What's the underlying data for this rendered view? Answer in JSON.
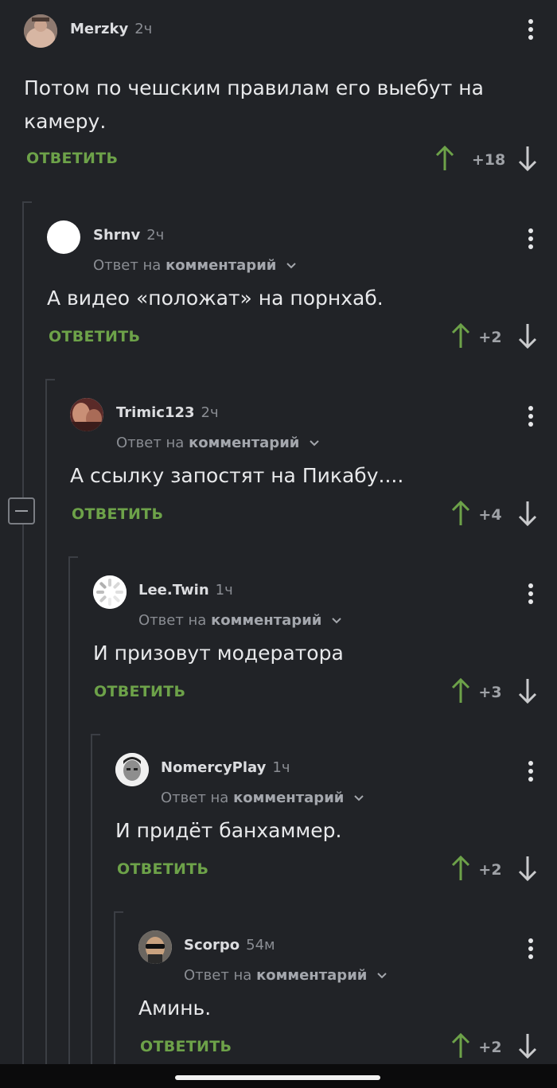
{
  "labels": {
    "reply_prefix": "Ответ на",
    "reply_target": "комментарий",
    "reply_button": "ОТВЕТИТЬ"
  },
  "colors": {
    "background": "#212327",
    "accent_green": "#6da249",
    "upvote": "#6da249",
    "downvote": "#c9cacc",
    "thread_line": "#3b3e44"
  },
  "comments": [
    {
      "author": "Merzky",
      "time": "2ч",
      "lines": [
        "Потом по чешским правилам его выебут на",
        "камеру."
      ],
      "score": "+18",
      "avatar": "avatar-photo"
    },
    {
      "author": "Shrnv",
      "time": "2ч",
      "lines": [
        "А видео «положат» на порнхаб."
      ],
      "score": "+2",
      "avatar": "avatar-blank"
    },
    {
      "author": "Trimic123",
      "time": "2ч",
      "lines": [
        "А ссылку запостят на Пикабу...."
      ],
      "score": "+4",
      "avatar": "avatar-photo"
    },
    {
      "author": "Lee.Twin",
      "time": "1ч",
      "lines": [
        "И призовут модератора"
      ],
      "score": "+3",
      "avatar": "avatar-spinner"
    },
    {
      "author": "NomercyPlay",
      "time": "1ч",
      "lines": [
        "И придёт банхаммер."
      ],
      "score": "+2",
      "avatar": "avatar-face"
    },
    {
      "author": "Scorpo",
      "time": "54м",
      "lines": [
        "Аминь."
      ],
      "score": "+2",
      "avatar": "avatar-sunglasses"
    }
  ],
  "icons": {
    "menu": "more-vertical-icon",
    "up": "arrow-up-icon",
    "down": "arrow-down-icon",
    "collapse": "minus-icon",
    "chevron": "chevron-down-icon"
  }
}
